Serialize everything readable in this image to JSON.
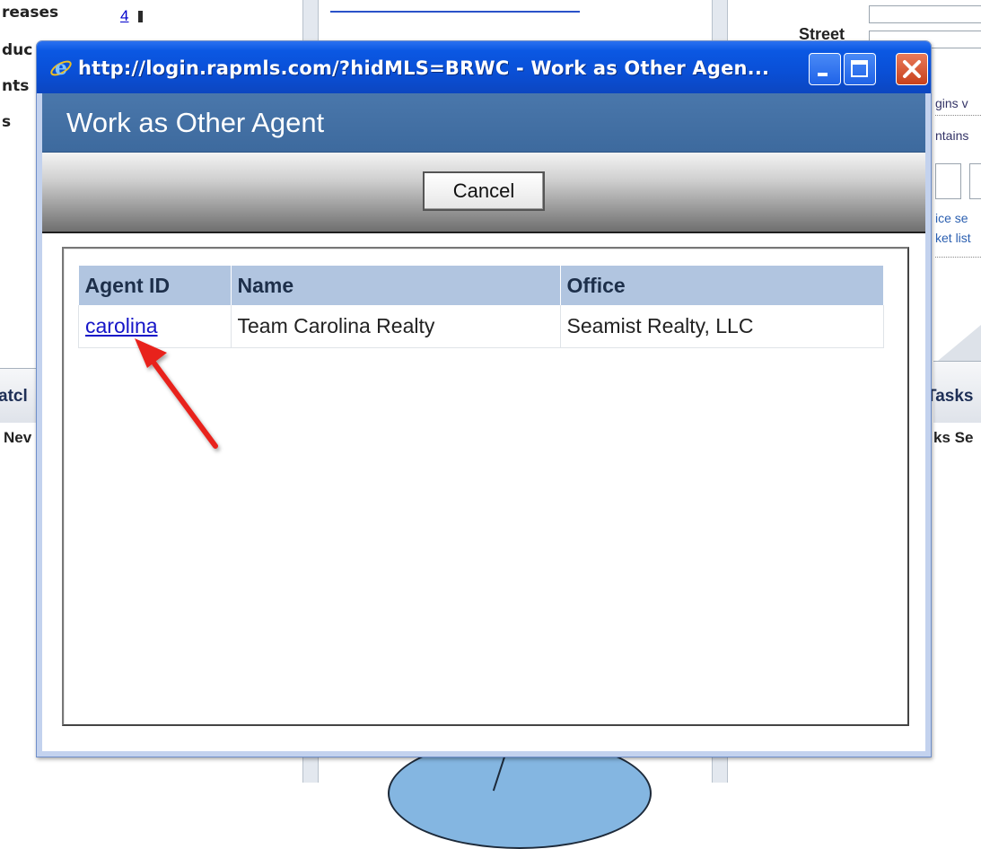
{
  "background": {
    "left_fragments": [
      "reases",
      "duc",
      "nts",
      "s"
    ],
    "count": "4",
    "street_label": "Street",
    "right_fragments": [
      "gins v",
      "ntains",
      "ice se",
      "ket list"
    ],
    "tab_left": "atcl",
    "tab_left_sub": "Nev",
    "tab_right": "Tasks",
    "tab_right_sub": "ks Se"
  },
  "window": {
    "title": "http://login.rapmls.com/?hidMLS=BRWC - Work as Other Agen...",
    "icon": "ie-icon",
    "controls": [
      "minimize-icon",
      "maximize-icon",
      "close-icon"
    ]
  },
  "dialog": {
    "heading": "Work as Other Agent",
    "cancel_label": "Cancel",
    "table": {
      "columns": [
        "Agent ID",
        "Name",
        "Office"
      ],
      "rows": [
        [
          "carolina",
          "Team Carolina Realty",
          "Seamist Realty, LLC"
        ]
      ]
    }
  },
  "colors": {
    "titlebar": "#0a4fd6",
    "header_band": "#4575a8",
    "table_header": "#b1c5e0",
    "arrow": "#e8221c"
  }
}
